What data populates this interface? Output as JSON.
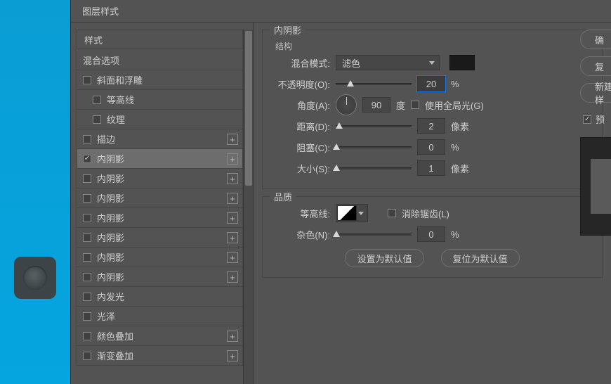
{
  "title": "图层样式",
  "sidebar": {
    "header": "样式",
    "blend": "混合选项",
    "items": [
      {
        "label": "斜面和浮雕",
        "checked": false,
        "plus": false,
        "sub": false
      },
      {
        "label": "等高线",
        "checked": false,
        "plus": false,
        "sub": true
      },
      {
        "label": "纹理",
        "checked": false,
        "plus": false,
        "sub": true
      },
      {
        "label": "描边",
        "checked": false,
        "plus": true,
        "sub": false
      },
      {
        "label": "内阴影",
        "checked": true,
        "plus": true,
        "sub": false,
        "selected": true
      },
      {
        "label": "内阴影",
        "checked": false,
        "plus": true,
        "sub": false
      },
      {
        "label": "内阴影",
        "checked": false,
        "plus": true,
        "sub": false
      },
      {
        "label": "内阴影",
        "checked": false,
        "plus": true,
        "sub": false
      },
      {
        "label": "内阴影",
        "checked": false,
        "plus": true,
        "sub": false
      },
      {
        "label": "内阴影",
        "checked": false,
        "plus": true,
        "sub": false
      },
      {
        "label": "内阴影",
        "checked": false,
        "plus": true,
        "sub": false
      },
      {
        "label": "内发光",
        "checked": false,
        "plus": false,
        "sub": false
      },
      {
        "label": "光泽",
        "checked": false,
        "plus": false,
        "sub": false
      },
      {
        "label": "颜色叠加",
        "checked": false,
        "plus": true,
        "sub": false
      },
      {
        "label": "渐变叠加",
        "checked": false,
        "plus": true,
        "sub": false
      }
    ]
  },
  "panel": {
    "effect_title": "内阴影",
    "structure": "结构",
    "quality": "品质",
    "labels": {
      "blend_mode": "混合模式:",
      "opacity": "不透明度(O):",
      "angle": "角度(A):",
      "distance": "距离(D):",
      "choke": "阻塞(C):",
      "size": "大小(S):",
      "contour": "等高线:",
      "noise": "杂色(N):",
      "degree": "度",
      "px": "像素",
      "pct": "%",
      "global_light": "使用全局光(G)",
      "antialias": "消除锯齿(L)"
    },
    "values": {
      "blend_mode": "滤色",
      "opacity": "20",
      "angle": "90",
      "distance": "2",
      "choke": "0",
      "size": "1",
      "noise": "0"
    },
    "buttons": {
      "default": "设置为默认值",
      "reset": "复位为默认值"
    }
  },
  "right": {
    "ok": "确",
    "cancel": "复",
    "newstyle": "新建样",
    "preview": "预"
  }
}
